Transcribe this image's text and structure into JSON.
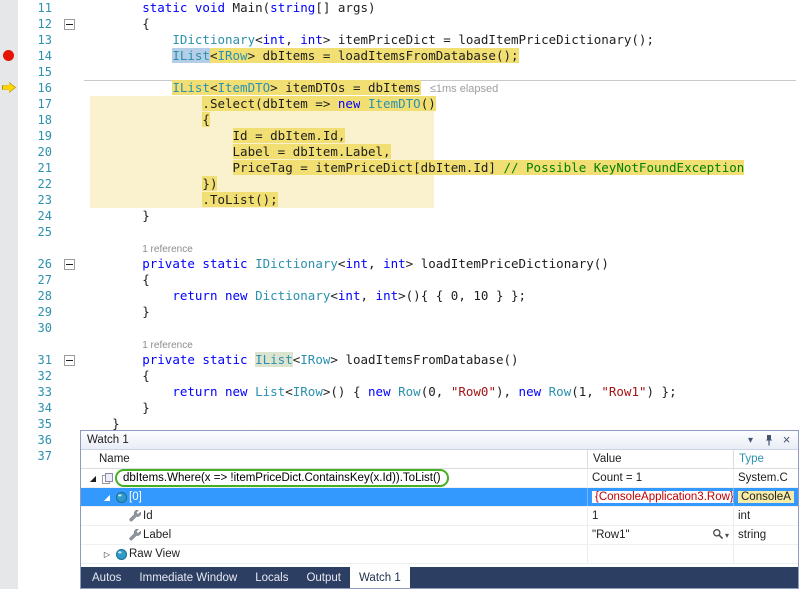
{
  "colors": {
    "keyword": "#0000FF",
    "type_name": "#2B91AF",
    "string_literal": "#A31515",
    "comment": "#008000",
    "line_number": "#2B91AF",
    "statement_highlight": "#F2DF74",
    "statement_highlight_pale": "#FAF2CF",
    "word_selection": "#B5CEE8",
    "reference_highlight": "#DCE3CE",
    "breakpoint_red": "#E51400",
    "current_arrow_yellow": "#FFD700",
    "watch_selection_blue": "#3399FF",
    "changed_value_red": "#C00000",
    "annotation_green": "#43B121",
    "tab_strip_blue": "#2D3E63"
  },
  "editor": {
    "breakpoint_line": 14,
    "current_statement_line": 16,
    "perf_tip": "≤1ms elapsed",
    "codelens_label": "1 reference",
    "lines": [
      {
        "n": "11",
        "segs": [
          [
            "p",
            "        "
          ],
          [
            "k",
            "static void"
          ],
          [
            "p",
            " Main("
          ],
          [
            "k",
            "string"
          ],
          [
            "p",
            "[] args)"
          ]
        ]
      },
      {
        "n": "12",
        "fold": true,
        "segs": [
          [
            "p",
            "        {"
          ]
        ]
      },
      {
        "n": "13",
        "segs": [
          [
            "p",
            "            "
          ],
          [
            "t",
            "IDictionary"
          ],
          [
            "p",
            "<"
          ],
          [
            "k",
            "int"
          ],
          [
            "p",
            ", "
          ],
          [
            "k",
            "int"
          ],
          [
            "p",
            "> itemPriceDict = loadItemPriceDictionary();"
          ]
        ]
      },
      {
        "n": "14",
        "segs": [
          [
            "p",
            "            "
          ],
          [
            "t sel",
            "IList"
          ],
          [
            "p h",
            "<"
          ],
          [
            "t h",
            "IRow"
          ],
          [
            "p h",
            "> dbItems = loadItemsFromDatabase();"
          ]
        ]
      },
      {
        "n": "15",
        "segs": []
      },
      {
        "n": "16",
        "segs": [
          [
            "p",
            "            "
          ],
          [
            "t h",
            "IList"
          ],
          [
            "p h",
            "<"
          ],
          [
            "t h",
            "ItemDTO"
          ],
          [
            "p h",
            "> itemDTOs = dbItems"
          ],
          [
            "g",
            "   ≤1ms elapsed"
          ]
        ]
      },
      {
        "n": "17",
        "segs": [
          [
            "p",
            "                "
          ],
          [
            "p h",
            ".Select(dbItem => "
          ],
          [
            "k h",
            "new"
          ],
          [
            "p h",
            " "
          ],
          [
            "t h",
            "ItemDTO"
          ],
          [
            "p h",
            "()"
          ]
        ]
      },
      {
        "n": "18",
        "segs": [
          [
            "p",
            "                "
          ],
          [
            "p h",
            "{"
          ]
        ]
      },
      {
        "n": "19",
        "segs": [
          [
            "p",
            "                    "
          ],
          [
            "p h",
            "Id = dbItem.Id,"
          ]
        ]
      },
      {
        "n": "20",
        "segs": [
          [
            "p",
            "                    "
          ],
          [
            "p h",
            "Label = dbItem.Label,"
          ]
        ]
      },
      {
        "n": "21",
        "segs": [
          [
            "p",
            "                    "
          ],
          [
            "p h",
            "PriceTag = itemPriceDict[dbItem.Id] "
          ],
          [
            "c h",
            "// Possible KeyNotFoundException"
          ]
        ]
      },
      {
        "n": "22",
        "segs": [
          [
            "p",
            "                "
          ],
          [
            "p h",
            "})"
          ]
        ]
      },
      {
        "n": "23",
        "segs": [
          [
            "p",
            "                "
          ],
          [
            "p h",
            ".ToList();"
          ]
        ]
      },
      {
        "n": "24",
        "segs": [
          [
            "p",
            "        }"
          ]
        ]
      },
      {
        "n": "25",
        "segs": []
      },
      {
        "n": "",
        "segs": [
          [
            "p",
            "        "
          ],
          [
            "cl",
            "1 reference"
          ]
        ]
      },
      {
        "n": "26",
        "fold": true,
        "segs": [
          [
            "p",
            "        "
          ],
          [
            "k",
            "private static"
          ],
          [
            "p",
            " "
          ],
          [
            "t",
            "IDictionary"
          ],
          [
            "p",
            "<"
          ],
          [
            "k",
            "int"
          ],
          [
            "p",
            ", "
          ],
          [
            "k",
            "int"
          ],
          [
            "p",
            "> loadItemPriceDictionary()"
          ]
        ]
      },
      {
        "n": "27",
        "segs": [
          [
            "p",
            "        {"
          ]
        ]
      },
      {
        "n": "28",
        "segs": [
          [
            "p",
            "            "
          ],
          [
            "k",
            "return"
          ],
          [
            "p",
            " "
          ],
          [
            "k",
            "new"
          ],
          [
            "p",
            " "
          ],
          [
            "t",
            "Dictionary"
          ],
          [
            "p",
            "<"
          ],
          [
            "k",
            "int"
          ],
          [
            "p",
            ", "
          ],
          [
            "k",
            "int"
          ],
          [
            "p",
            ">(){ { 0, 10 } };"
          ]
        ]
      },
      {
        "n": "29",
        "segs": [
          [
            "p",
            "        }"
          ]
        ]
      },
      {
        "n": "30",
        "segs": []
      },
      {
        "n": "",
        "segs": [
          [
            "p",
            "        "
          ],
          [
            "cl",
            "1 reference"
          ]
        ]
      },
      {
        "n": "31",
        "fold": true,
        "segs": [
          [
            "p",
            "        "
          ],
          [
            "k",
            "private static"
          ],
          [
            "p",
            " "
          ],
          [
            "t ref",
            "IList"
          ],
          [
            "p",
            "<"
          ],
          [
            "t",
            "IRow"
          ],
          [
            "p",
            "> loadItemsFromDatabase()"
          ]
        ]
      },
      {
        "n": "32",
        "segs": [
          [
            "p",
            "        {"
          ]
        ]
      },
      {
        "n": "33",
        "segs": [
          [
            "p",
            "            "
          ],
          [
            "k",
            "return"
          ],
          [
            "p",
            " "
          ],
          [
            "k",
            "new"
          ],
          [
            "p",
            " "
          ],
          [
            "t",
            "List"
          ],
          [
            "p",
            "<"
          ],
          [
            "t",
            "IRow"
          ],
          [
            "p",
            ">() { "
          ],
          [
            "k",
            "new"
          ],
          [
            "p",
            " "
          ],
          [
            "t",
            "Row"
          ],
          [
            "p",
            "(0, "
          ],
          [
            "s",
            "\"Row0\""
          ],
          [
            "p",
            "), "
          ],
          [
            "k",
            "new"
          ],
          [
            "p",
            " "
          ],
          [
            "t",
            "Row"
          ],
          [
            "p",
            "(1, "
          ],
          [
            "s",
            "\"Row1\""
          ],
          [
            "p",
            ") };"
          ]
        ]
      },
      {
        "n": "34",
        "segs": [
          [
            "p",
            "        }"
          ]
        ]
      },
      {
        "n": "35",
        "segs": [
          [
            "p",
            "    }"
          ]
        ]
      },
      {
        "n": "36",
        "segs": [
          [
            "p",
            "}"
          ]
        ]
      },
      {
        "n": "37",
        "segs": []
      }
    ]
  },
  "watch": {
    "title": "Watch 1",
    "window_buttons": {
      "menu": "▾",
      "close": "×"
    },
    "columns": [
      "Name",
      "Value",
      "Type"
    ],
    "icons": {
      "expanded": "◢",
      "collapsed": "▷",
      "dropdown": "▾"
    },
    "rows": [
      {
        "indent": 0,
        "expander": "expanded",
        "icon": "expression",
        "name": "dbItems.Where(x => !itemPriceDict.ContainsKey(x.Id)).ToList()",
        "boxed": true,
        "value": "Count = 1",
        "type": "System.C"
      },
      {
        "indent": 1,
        "expander": "expanded",
        "icon": "object",
        "name": "[0]",
        "value": "{ConsoleApplication3.Row}",
        "type": "ConsoleA",
        "selected": true,
        "value_changed": true,
        "type_highlighted": true
      },
      {
        "indent": 2,
        "expander": "",
        "icon": "property",
        "name": "Id",
        "value": "1",
        "type": "int"
      },
      {
        "indent": 2,
        "expander": "",
        "icon": "property",
        "name": "Label",
        "value": "\"Row1\"",
        "type": "string",
        "value_tools": true
      },
      {
        "indent": 1,
        "expander": "collapsed",
        "icon": "object",
        "name": "Raw View",
        "value": "",
        "type": ""
      }
    ]
  },
  "debug_tabs": {
    "items": [
      "Autos",
      "Immediate Window",
      "Locals",
      "Output",
      "Watch 1"
    ],
    "active": "Watch 1"
  }
}
